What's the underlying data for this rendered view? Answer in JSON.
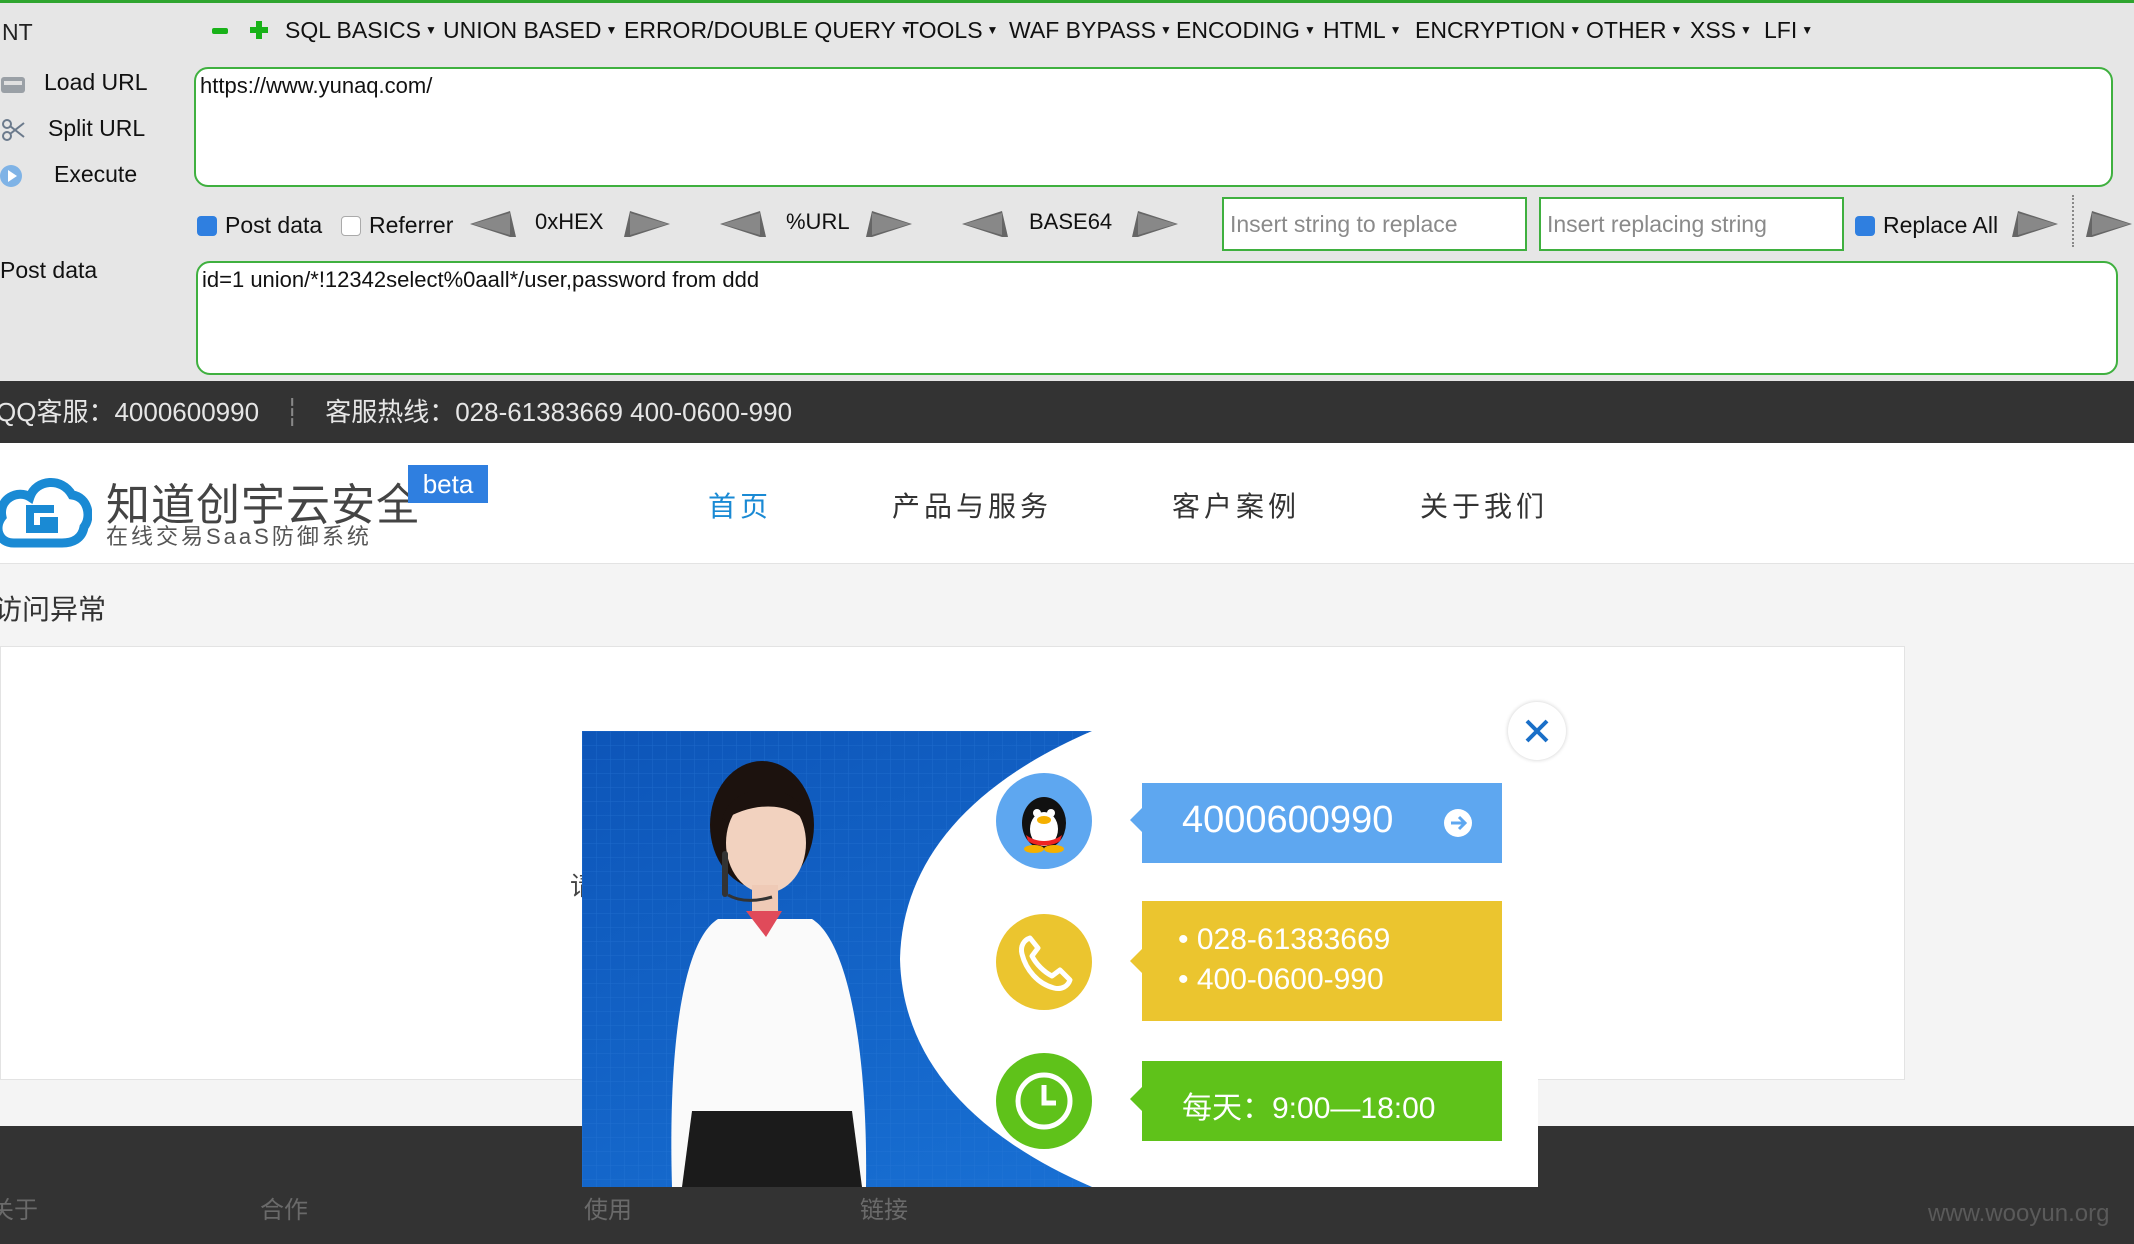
{
  "hackbar": {
    "cut_label": "NT",
    "menu": [
      "SQL BASICS",
      "UNION BASED",
      "ERROR/DOUBLE QUERY",
      "TOOLS",
      "WAF BYPASS",
      "ENCODING",
      "HTML",
      "ENCRYPTION",
      "OTHER",
      "XSS",
      "LFI"
    ],
    "side": {
      "load": "Load URL",
      "split": "Split URL",
      "execute": "Execute",
      "post": "Post data"
    },
    "url_value": "https://www.yunaq.com/",
    "post_value": "id=1 union/*!12342select%0aall*/user,password from ddd",
    "options": {
      "post_data": "Post data",
      "referrer": "Referrer",
      "replace_all": "Replace All"
    },
    "encoders": [
      "0xHEX",
      "%URL",
      "BASE64"
    ],
    "replace_placeholder": "Insert string to replace",
    "replacing_placeholder": "Insert replacing string",
    "colors": {
      "border": "#3fb03f",
      "bg": "#e6e6e6"
    }
  },
  "topbar": {
    "qq": "QQ客服：4000600990",
    "separator": "┆",
    "hotline": "客服热线：028-61383669  400-0600-990"
  },
  "brand": {
    "name": "知道创宇云安全",
    "tagline": "在线交易SaaS防御系统",
    "badge": "beta",
    "color": "#1a8ad4"
  },
  "nav": {
    "items": [
      "首页",
      "产品与服务",
      "客户案例",
      "关于我们"
    ],
    "active_color": "#1a8ad4"
  },
  "page": {
    "heading": "访问异常",
    "obscured_char": "请"
  },
  "popup": {
    "qq": "4000600990",
    "phones": [
      "028-61383669",
      "400-0600-990"
    ],
    "hours": "每天：9:00—18:00",
    "colors": {
      "qq": "#5ea7f0",
      "phone": "#ebc52f",
      "hours": "#5fc21a",
      "bg": "#1565c8"
    }
  },
  "footer": {
    "links": [
      "关于",
      "合作",
      "使用",
      "链接"
    ]
  },
  "watermark": "www.wooyun.org"
}
